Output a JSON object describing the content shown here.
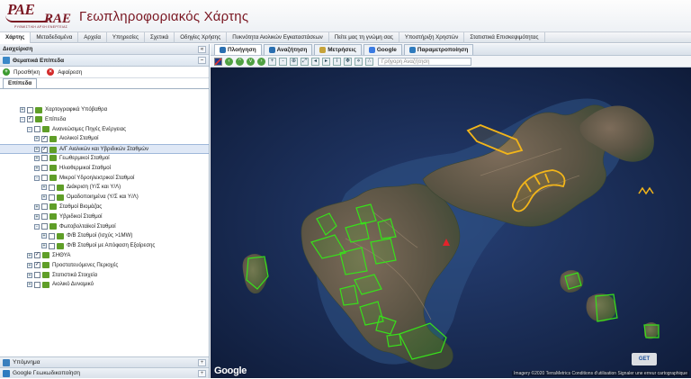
{
  "header": {
    "logo_primary": "PAE",
    "logo_secondary": "RAE",
    "logo_tagline": "ΡΥΘΜΙΣΤΙΚΗ ΑΡΧΗ ΕΝΕΡΓΕΙΑΣ",
    "title": "Γεωπληροφοριακός Χάρτης"
  },
  "menu": [
    {
      "label": "Χάρτης",
      "active": true
    },
    {
      "label": "Μεταδεδομένα"
    },
    {
      "label": "Αρχεία"
    },
    {
      "label": "Υπηρεσίες"
    },
    {
      "label": "Σχετικά"
    },
    {
      "label": "Οδηγίες Χρήσης"
    },
    {
      "label": "Πυκνότητα Αιολικών Εγκαταστάσεων"
    },
    {
      "label": "Πείτε μας τη γνώμη σας"
    },
    {
      "label": "Υποστήριξη Χρηστών"
    },
    {
      "label": "Στατιστικά Επισκεψιμότητας"
    }
  ],
  "left_panel": {
    "title": "Διαχείριση",
    "thematic_title": "Θεματικά Επίπεδα",
    "add_label": "Προσθήκη",
    "remove_label": "Αφαίρεση",
    "tab_label": "Επίπεδα",
    "tree": [
      {
        "label": "Χαρτογραφικά Υπόβαθρα",
        "level": 1,
        "checked": false,
        "exp": "+"
      },
      {
        "label": "Επίπεδα",
        "level": 1,
        "checked": true,
        "exp": "-"
      },
      {
        "label": "Ανανεώσιμες Πηγές Ενέργειας",
        "level": 2,
        "checked": false,
        "exp": "-"
      },
      {
        "label": "Αιολικοί Σταθμοί",
        "level": 3,
        "checked": true,
        "exp": "+"
      },
      {
        "label": "Α/Γ Αιολικών και Υβριδικών Σταθμών",
        "level": 3,
        "checked": true,
        "exp": "+",
        "selected": true
      },
      {
        "label": "Γεωθερμικοί Σταθμοί",
        "level": 3,
        "checked": false,
        "exp": "+"
      },
      {
        "label": "Ηλιοθερμικοί Σταθμοί",
        "level": 3,
        "checked": false,
        "exp": "+"
      },
      {
        "label": "Μικροί Υδροηλεκτρικοί Σταθμοί",
        "level": 3,
        "checked": false,
        "exp": "-"
      },
      {
        "label": "Διάκριση (Υ/Σ και Υ/Λ)",
        "level": 4,
        "checked": false,
        "exp": "+"
      },
      {
        "label": "Ομαδοποιημένα (Υ/Σ και Υ/Λ)",
        "level": 4,
        "checked": false,
        "exp": "+"
      },
      {
        "label": "Σταθμοί Βιομάζας",
        "level": 3,
        "checked": false,
        "exp": "+"
      },
      {
        "label": "Υβριδικοί Σταθμοί",
        "level": 3,
        "checked": false,
        "exp": "+"
      },
      {
        "label": "Φωτοβολταϊκοί Σταθμοί",
        "level": 3,
        "checked": false,
        "exp": "-"
      },
      {
        "label": "Φ/Β Σταθμοί (Ισχύς >1MW)",
        "level": 4,
        "checked": false,
        "exp": "+"
      },
      {
        "label": "Φ/Β Σταθμοί με Απόφαση Εξαίρεσης",
        "level": 4,
        "checked": false,
        "exp": "+"
      },
      {
        "label": "ΣΗΘΥΑ",
        "level": 2,
        "checked": true,
        "exp": "+"
      },
      {
        "label": "Προστατευόμενες Περιοχές",
        "level": 2,
        "checked": true,
        "exp": "+"
      },
      {
        "label": "Στατιστικά Στοιχεία",
        "level": 2,
        "checked": false,
        "exp": "+"
      },
      {
        "label": "Αιολικό Δυναμικό",
        "level": 2,
        "checked": false,
        "exp": "+"
      }
    ],
    "legend_title": "Υπόμνημα",
    "geolocation_title": "Google Γεωκωδικοποίηση"
  },
  "map_tabs": [
    {
      "label": "Πλοήγηση",
      "active": true,
      "icon": "navigation-icon",
      "color": "#2a6fb0"
    },
    {
      "label": "Αναζήτηση",
      "icon": "magnifier-icon",
      "color": "#2a6fb0"
    },
    {
      "label": "Μετρήσεις",
      "icon": "ruler-icon",
      "color": "#c6a33a"
    },
    {
      "label": "Google",
      "icon": "google-icon",
      "color": "#3b7be2"
    },
    {
      "label": "Παραμετροποίηση",
      "icon": "settings-icon",
      "color": "#2f7bbd"
    }
  ],
  "map_search": {
    "placeholder": "Γρήγορη Αναζήτηση"
  },
  "map": {
    "google_logo": "Google",
    "copyright": "Imagery ©2020 TerraMetrics    Conditions d'utilisation    Signaler une erreur cartographique",
    "provider_logo": "GET",
    "zone_colors": {
      "wind_parks": "#f2b51a",
      "protected_areas": "#38e01b",
      "turbine_marker": "#e3232b"
    }
  }
}
